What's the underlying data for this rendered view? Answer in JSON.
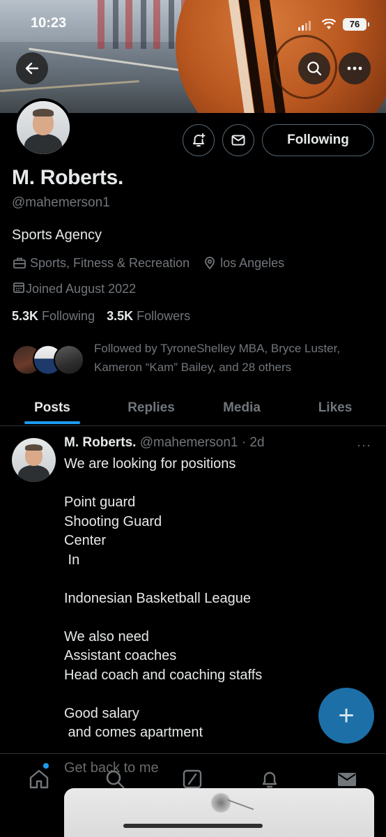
{
  "status_bar": {
    "time": "10:23",
    "battery": "76"
  },
  "profile": {
    "name": "M. Roberts.",
    "handle": "@mahemerson1",
    "bio": "Sports Agency",
    "category": "Sports, Fitness & Recreation",
    "location": "los Angeles",
    "joined": "Joined August 2022",
    "following_count": "5.3K",
    "following_label": "Following",
    "followers_count": "3.5K",
    "followers_label": "Followers",
    "follow_button": "Following",
    "followed_by": "Followed by TyroneShelley MBA, Bryce Luster, Kameron “Kam” Bailey, and 28 others"
  },
  "tabs": [
    {
      "label": "Posts",
      "active": true
    },
    {
      "label": "Replies"
    },
    {
      "label": "Media"
    },
    {
      "label": "Likes"
    }
  ],
  "post": {
    "author": "M. Roberts.",
    "handle": "@mahemerson1",
    "separator": " · ",
    "time": "2d",
    "more": "···",
    "body": "We are looking for positions\n\nPoint guard\nShooting Guard\nCenter\n In\n\nIndonesian Basketball League\n\nWe also need\nAssistant coaches\nHead coach and coaching staffs\n\nGood salary\n and comes apartment",
    "faded_line": "Get back to me"
  },
  "fab": {
    "icon": "plus-icon",
    "label": "+"
  },
  "bottom_nav": [
    "home-icon",
    "search-icon",
    "grok-icon",
    "notifications-icon",
    "messages-icon"
  ],
  "colors": {
    "accent": "#1d9bf0",
    "fab": "#1d6fa8",
    "muted": "#71767b",
    "text": "#e7e9ea"
  }
}
